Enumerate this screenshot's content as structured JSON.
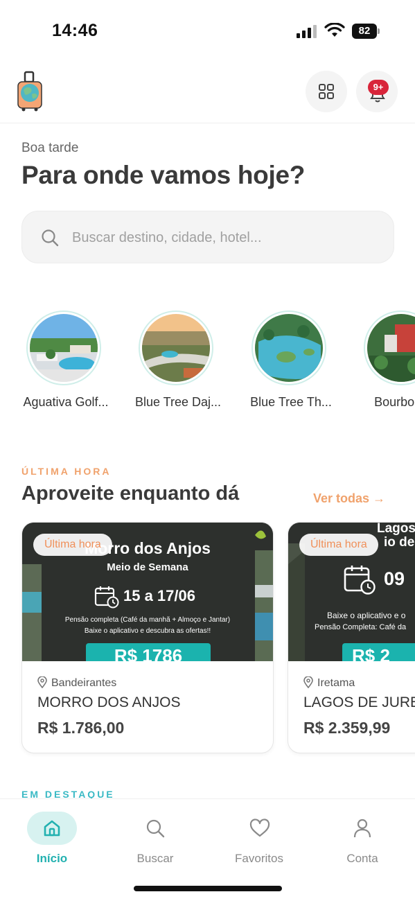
{
  "status_bar": {
    "time": "14:46",
    "battery": "82"
  },
  "header": {
    "logo_icon": "suitcase-globe-icon",
    "grid_icon": "grid-icon",
    "notification_icon": "bell-icon",
    "notification_badge": "9+"
  },
  "greeting": "Boa tarde",
  "headline": "Para onde vamos hoje?",
  "search": {
    "placeholder": "Buscar destino, cidade, hotel..."
  },
  "stories": [
    {
      "label": "Aguativa Golf..."
    },
    {
      "label": "Blue Tree Daj..."
    },
    {
      "label": "Blue Tree Th..."
    },
    {
      "label": "Bourbon T"
    }
  ],
  "last_minute": {
    "kicker": "ÚLTIMA HORA",
    "title": "Aproveite enquanto dá",
    "see_all": "Ver todas →",
    "cards": [
      {
        "tag": "Última hora",
        "poster_title": "Morro dos Anjos",
        "poster_subtitle": "Meio de Semana",
        "poster_dates": "15 a 17/06",
        "poster_line1": "Pensão completa (Café da manhã + Almoço e Jantar)",
        "poster_line2": "Baixe o aplicativo e descubra as ofertas!!",
        "poster_price": "R$ 1786",
        "location": "Bandeirantes",
        "name": "MORRO DOS ANJOS",
        "price": "R$ 1.786,00"
      },
      {
        "tag": "Última hora",
        "poster_title": "Lagos de",
        "poster_subtitle": "io de",
        "poster_dates": "09",
        "poster_line1": "Baixe o aplicativo e o",
        "poster_line2": "Pensão Completa: Café da",
        "poster_price": "R$ 2",
        "location": "Iretama",
        "name": "LAGOS DE JURE",
        "price": "R$ 2.359,99"
      }
    ]
  },
  "featured": {
    "kicker": "EM DESTAQUE"
  },
  "nav": [
    {
      "label": "Início",
      "icon": "home-icon",
      "active": true
    },
    {
      "label": "Buscar",
      "icon": "search-icon",
      "active": false
    },
    {
      "label": "Favoritos",
      "icon": "heart-icon",
      "active": false
    },
    {
      "label": "Conta",
      "icon": "user-icon",
      "active": false
    }
  ],
  "colors": {
    "accent_teal": "#22b1b0",
    "accent_orange": "#f0a26c",
    "badge_red": "#d8253a"
  }
}
